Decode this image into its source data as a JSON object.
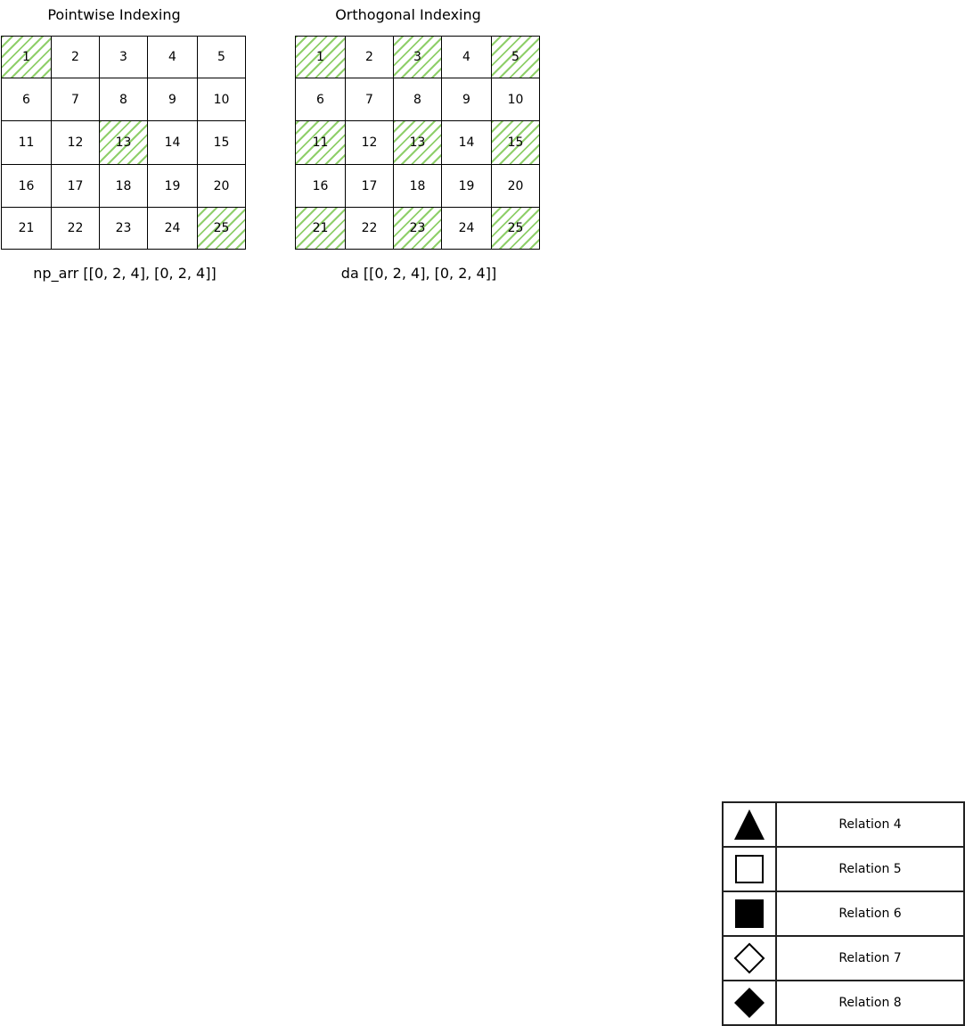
{
  "panels": [
    {
      "title": "Pointwise Indexing",
      "caption": "np_arr [[0, 2, 4], [0, 2, 4]]",
      "cells": [
        {
          "label": "1",
          "selected": true
        },
        {
          "label": "2",
          "selected": false
        },
        {
          "label": "3",
          "selected": false
        },
        {
          "label": "4",
          "selected": false
        },
        {
          "label": "5",
          "selected": false
        },
        {
          "label": "6",
          "selected": false
        },
        {
          "label": "7",
          "selected": false
        },
        {
          "label": "8",
          "selected": false
        },
        {
          "label": "9",
          "selected": false
        },
        {
          "label": "10",
          "selected": false
        },
        {
          "label": "11",
          "selected": false
        },
        {
          "label": "12",
          "selected": false
        },
        {
          "label": "13",
          "selected": true
        },
        {
          "label": "14",
          "selected": false
        },
        {
          "label": "15",
          "selected": false
        },
        {
          "label": "16",
          "selected": false
        },
        {
          "label": "17",
          "selected": false
        },
        {
          "label": "18",
          "selected": false
        },
        {
          "label": "19",
          "selected": false
        },
        {
          "label": "20",
          "selected": false
        },
        {
          "label": "21",
          "selected": false
        },
        {
          "label": "22",
          "selected": false
        },
        {
          "label": "23",
          "selected": false
        },
        {
          "label": "24",
          "selected": false
        },
        {
          "label": "25",
          "selected": true
        }
      ]
    },
    {
      "title": "Orthogonal Indexing",
      "caption": "da [[0, 2, 4], [0, 2, 4]]",
      "cells": [
        {
          "label": "1",
          "selected": true
        },
        {
          "label": "2",
          "selected": false
        },
        {
          "label": "3",
          "selected": true
        },
        {
          "label": "4",
          "selected": false
        },
        {
          "label": "5",
          "selected": true
        },
        {
          "label": "6",
          "selected": false
        },
        {
          "label": "7",
          "selected": false
        },
        {
          "label": "8",
          "selected": false
        },
        {
          "label": "9",
          "selected": false
        },
        {
          "label": "10",
          "selected": false
        },
        {
          "label": "11",
          "selected": true
        },
        {
          "label": "12",
          "selected": false
        },
        {
          "label": "13",
          "selected": true
        },
        {
          "label": "14",
          "selected": false
        },
        {
          "label": "15",
          "selected": true
        },
        {
          "label": "16",
          "selected": false
        },
        {
          "label": "17",
          "selected": false
        },
        {
          "label": "18",
          "selected": false
        },
        {
          "label": "19",
          "selected": false
        },
        {
          "label": "20",
          "selected": false
        },
        {
          "label": "21",
          "selected": true
        },
        {
          "label": "22",
          "selected": false
        },
        {
          "label": "23",
          "selected": true
        },
        {
          "label": "24",
          "selected": false
        },
        {
          "label": "25",
          "selected": true
        }
      ]
    }
  ],
  "highlight_color": "#8fcf6a",
  "legend": [
    {
      "symbol": "filled-triangle-icon",
      "label": "Relation 4"
    },
    {
      "symbol": "hollow-square-icon",
      "label": "Relation 5"
    },
    {
      "symbol": "filled-square-icon",
      "label": "Relation 6"
    },
    {
      "symbol": "hollow-diamond-icon",
      "label": "Relation 7"
    },
    {
      "symbol": "filled-diamond-icon",
      "label": "Relation 8"
    }
  ]
}
